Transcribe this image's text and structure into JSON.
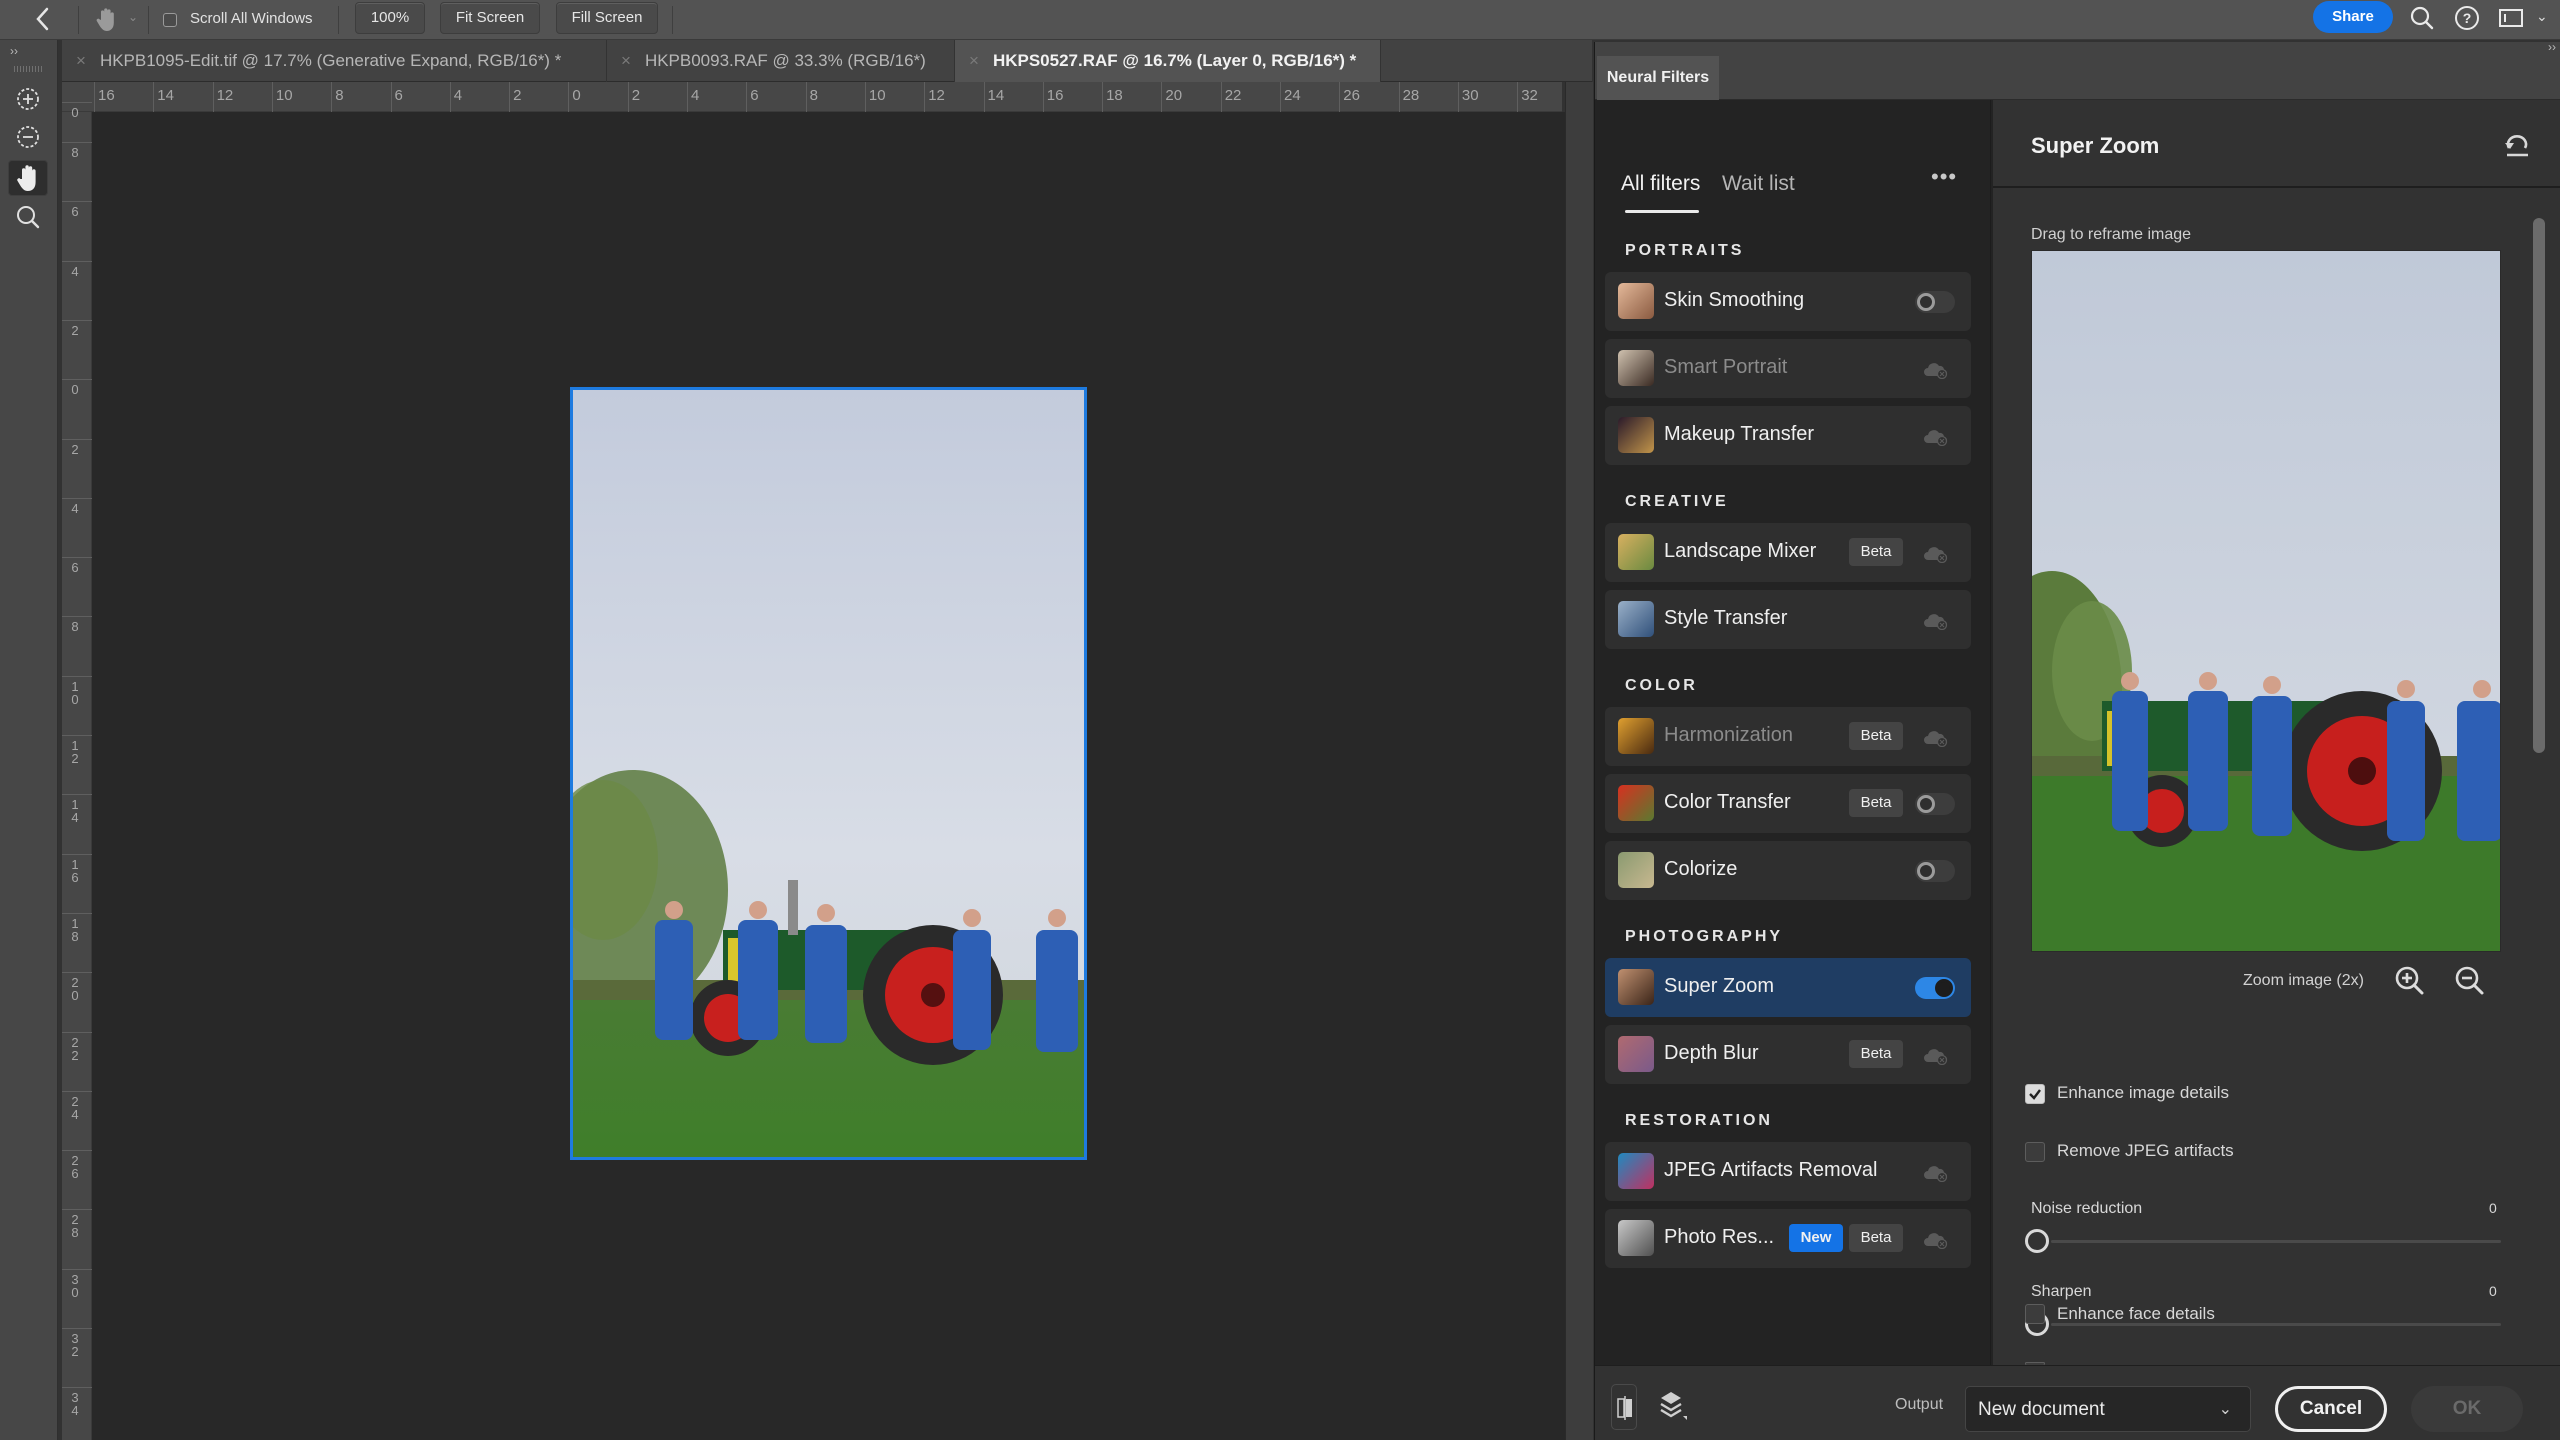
{
  "options_bar": {
    "back_icon": "chevron-left-icon",
    "tool_icon": "hand-icon",
    "scroll_all_windows": {
      "label": "Scroll All Windows",
      "checked": false
    },
    "buttons": [
      "100%",
      "Fit Screen",
      "Fill Screen"
    ],
    "share_label": "Share",
    "right_icons": [
      "search-icon",
      "help-icon",
      "workspace-icon",
      "chevron-down-icon"
    ]
  },
  "document_tabs": [
    {
      "title": "HKPB1095-Edit.tif @ 17.7% (Generative Expand, RGB/16*) *",
      "active": false
    },
    {
      "title": "HKPB0093.RAF @ 33.3% (RGB/16*)",
      "active": false
    },
    {
      "title": "HKPS0527.RAF @ 16.7% (Layer 0, RGB/16*) *",
      "active": true
    }
  ],
  "tools": [
    {
      "name": "zoom-in-tool",
      "active": false
    },
    {
      "name": "zoom-out-tool",
      "active": false
    },
    {
      "name": "hand-tool",
      "active": true
    },
    {
      "name": "zoom-tool",
      "active": false
    }
  ],
  "ruler": {
    "horizontal_ticks": [
      "16",
      "14",
      "12",
      "10",
      "8",
      "6",
      "4",
      "2",
      "0",
      "2",
      "4",
      "6",
      "8",
      "10",
      "12",
      "14",
      "16",
      "18",
      "20",
      "22",
      "24",
      "26",
      "28",
      "30",
      "32"
    ],
    "vertical_ticks": [
      "0",
      "8",
      "6",
      "4",
      "2",
      "0",
      "2",
      "4",
      "6",
      "8",
      "10",
      "12",
      "14",
      "16",
      "18",
      "20",
      "22",
      "24",
      "26",
      "28",
      "30",
      "32",
      "34"
    ]
  },
  "neural_filters": {
    "panel_title": "Neural Filters",
    "list_tabs": [
      {
        "label": "All filters",
        "active": true
      },
      {
        "label": "Wait list",
        "active": false
      }
    ],
    "more_label": "•••",
    "sections": [
      {
        "title": "PORTRAITS",
        "filters": [
          {
            "name": "Skin Smoothing",
            "state": "toggle-off",
            "disabled": false,
            "badges": []
          },
          {
            "name": "Smart Portrait",
            "state": "cloud",
            "disabled": true,
            "badges": []
          },
          {
            "name": "Makeup Transfer",
            "state": "cloud",
            "disabled": false,
            "badges": []
          }
        ]
      },
      {
        "title": "CREATIVE",
        "filters": [
          {
            "name": "Landscape Mixer",
            "state": "cloud",
            "disabled": false,
            "badges": [
              "Beta"
            ]
          },
          {
            "name": "Style Transfer",
            "state": "cloud",
            "disabled": false,
            "badges": []
          }
        ]
      },
      {
        "title": "COLOR",
        "filters": [
          {
            "name": "Harmonization",
            "state": "cloud",
            "disabled": true,
            "badges": [
              "Beta"
            ]
          },
          {
            "name": "Color Transfer",
            "state": "toggle-off",
            "disabled": false,
            "badges": [
              "Beta"
            ]
          },
          {
            "name": "Colorize",
            "state": "toggle-off",
            "disabled": false,
            "badges": []
          }
        ]
      },
      {
        "title": "PHOTOGRAPHY",
        "filters": [
          {
            "name": "Super Zoom",
            "state": "toggle-on",
            "disabled": false,
            "selected": true,
            "badges": []
          },
          {
            "name": "Depth Blur",
            "state": "cloud",
            "disabled": false,
            "badges": [
              "Beta"
            ]
          }
        ]
      },
      {
        "title": "RESTORATION",
        "filters": [
          {
            "name": "JPEG Artifacts Removal",
            "state": "cloud",
            "disabled": false,
            "badges": []
          },
          {
            "name": "Photo Res...",
            "state": "cloud",
            "disabled": false,
            "badges": [
              "New",
              "Beta"
            ]
          }
        ]
      }
    ],
    "settings": {
      "title": "Super Zoom",
      "reframe_hint": "Drag to reframe image",
      "zoom_label": "Zoom image (2x)",
      "checkboxes": [
        {
          "label": "Enhance image details",
          "checked": true
        },
        {
          "label": "Remove JPEG artifacts",
          "checked": false
        },
        {
          "label": "Enhance face details",
          "checked": false
        }
      ],
      "sliders": [
        {
          "label": "Noise reduction",
          "value": "0"
        },
        {
          "label": "Sharpen",
          "value": "0"
        }
      ]
    },
    "footer": {
      "output_label": "Output",
      "output_value": "New document",
      "cancel_label": "Cancel",
      "ok_label": "OK"
    }
  },
  "colors": {
    "accent_blue": "#1473e6",
    "selection_blue": "#1f3d63",
    "toggle_on": "#2d87e6",
    "document_border": "#1e7be0"
  }
}
